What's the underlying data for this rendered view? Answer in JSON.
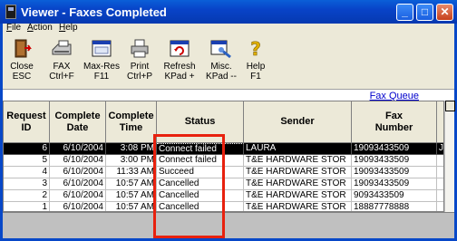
{
  "window": {
    "title": "Viewer - Faxes Completed"
  },
  "menu": [
    {
      "label": "File",
      "accel": "F",
      "rest": "ile"
    },
    {
      "label": "Action",
      "accel": "A",
      "rest": "ction"
    },
    {
      "label": "Help",
      "accel": "H",
      "rest": "elp"
    }
  ],
  "toolbar": [
    {
      "id": "close",
      "line1": "Close",
      "line2": "ESC",
      "icon": "close-door-icon"
    },
    {
      "id": "fax",
      "line1": "FAX",
      "line2": "Ctrl+F",
      "icon": "fax-machine-icon"
    },
    {
      "id": "maxres",
      "line1": "Max-Res",
      "line2": "F11",
      "icon": "maximize-window-icon"
    },
    {
      "id": "print",
      "line1": "Print",
      "line2": "Ctrl+P",
      "icon": "printer-icon"
    },
    {
      "id": "refresh",
      "line1": "Refresh",
      "line2": "KPad +",
      "icon": "refresh-icon"
    },
    {
      "id": "misc",
      "line1": "Misc.",
      "line2": "KPad --",
      "icon": "misc-tools-icon"
    },
    {
      "id": "help",
      "line1": "Help",
      "line2": "F1",
      "icon": "help-question-icon"
    }
  ],
  "link": {
    "fax_queue": "Fax Queue"
  },
  "table": {
    "headers": [
      {
        "l1": "Request",
        "l2": "ID"
      },
      {
        "l1": "Complete",
        "l2": "Date"
      },
      {
        "l1": "Complete",
        "l2": "Time"
      },
      {
        "l1": "Status",
        "l2": ""
      },
      {
        "l1": "Sender",
        "l2": ""
      },
      {
        "l1": "Fax",
        "l2": "Number"
      }
    ],
    "rows": [
      {
        "id": "6",
        "date": "6/10/2004",
        "time": "3:08 PM",
        "status": "Connect failed",
        "sender": "LAURA",
        "fax": "19093433509",
        "extra": "J",
        "selected": true
      },
      {
        "id": "5",
        "date": "6/10/2004",
        "time": "3:00 PM",
        "status": "Connect failed",
        "sender": "T&E HARDWARE STOR",
        "fax": "19093433509",
        "extra": "",
        "selected": false
      },
      {
        "id": "4",
        "date": "6/10/2004",
        "time": "11:33 AM",
        "status": "Succeed",
        "sender": "T&E HARDWARE STOR",
        "fax": "19093433509",
        "extra": "",
        "selected": false
      },
      {
        "id": "3",
        "date": "6/10/2004",
        "time": "10:57 AM",
        "status": "Cancelled",
        "sender": "T&E HARDWARE STOR",
        "fax": "19093433509",
        "extra": "",
        "selected": false
      },
      {
        "id": "2",
        "date": "6/10/2004",
        "time": "10:57 AM",
        "status": "Cancelled",
        "sender": "T&E HARDWARE STOR",
        "fax": "9093433509",
        "extra": "",
        "selected": false
      },
      {
        "id": "1",
        "date": "6/10/2004",
        "time": "10:57 AM",
        "status": "Cancelled",
        "sender": "T&E HARDWARE STOR",
        "fax": "18887778888",
        "extra": "",
        "selected": false
      }
    ]
  },
  "colors": {
    "annotation": "#e8210e",
    "title_bar": "#0843c8",
    "link": "#0000cc"
  }
}
